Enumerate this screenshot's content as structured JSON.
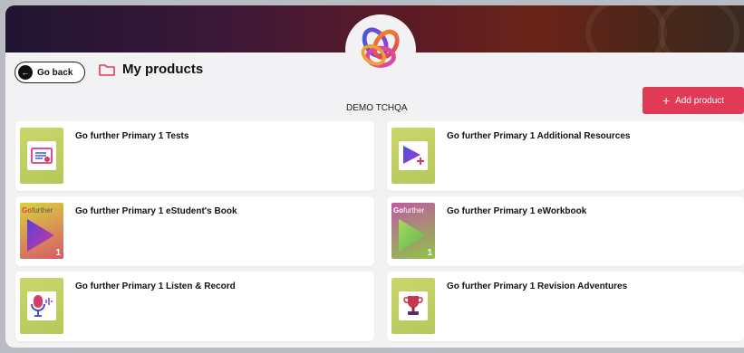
{
  "header": {
    "go_back_label": "Go back",
    "page_title": "My products",
    "organization": "DEMO TCHQA",
    "add_product_label": "Add product"
  },
  "products": [
    {
      "name": "Go further Primary 1 Tests",
      "icon": "test-document-icon"
    },
    {
      "name": "Go further Primary 1 Additional Resources",
      "icon": "play-plus-icon"
    },
    {
      "name": "Go further Primary 1 eStudent's Book",
      "icon": "book-cover",
      "brand": "Go",
      "brand_sub": "further",
      "level": "1"
    },
    {
      "name": "Go further Primary 1 eWorkbook",
      "icon": "book-cover",
      "brand": "Go",
      "brand_sub": "further",
      "level": "1"
    },
    {
      "name": "Go further Primary 1 Listen & Record",
      "icon": "microphone-icon"
    },
    {
      "name": "Go further Primary 1 Revision Adventures",
      "icon": "trophy-icon"
    }
  ],
  "colors": {
    "accent": "#e03a57",
    "card_thumb_green": "#c9d66a"
  }
}
